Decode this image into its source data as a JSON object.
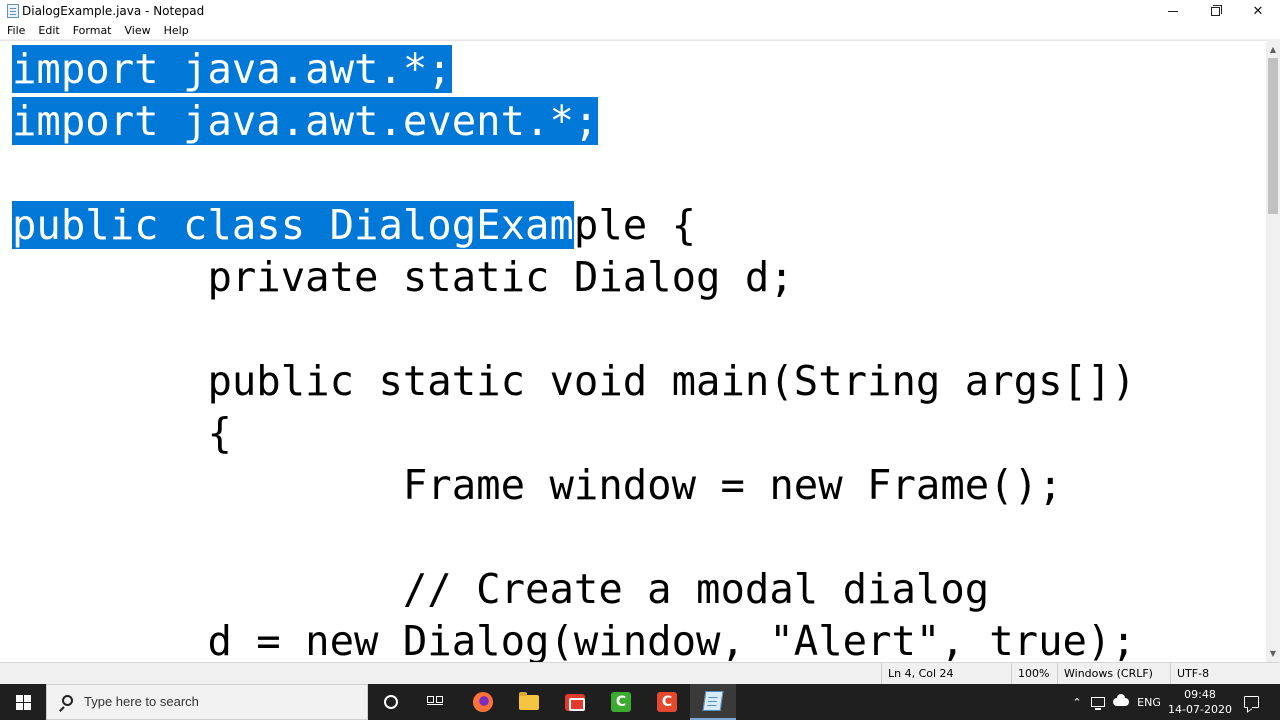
{
  "window": {
    "title": "DialogExample.java - Notepad",
    "controls": {
      "minimize_icon": "minimize-icon",
      "maximize_icon": "restore-icon",
      "close_icon": "close-icon"
    }
  },
  "menu": {
    "items": [
      "File",
      "Edit",
      "Format",
      "View",
      "Help"
    ]
  },
  "editor": {
    "selection_color": "#0078d7",
    "lines": [
      {
        "sel": "import java.awt.*;",
        "rest": ""
      },
      {
        "sel": "import java.awt.event.*;",
        "rest": ""
      },
      {
        "sel": "",
        "rest": ""
      },
      {
        "sel": "public class DialogExam",
        "rest": "ple {"
      },
      {
        "sel": "",
        "rest": "\t\tprivate static Dialog d;"
      },
      {
        "sel": "",
        "rest": ""
      },
      {
        "sel": "",
        "rest": "\t\tpublic static void main(String args[])"
      },
      {
        "sel": "",
        "rest": "\t\t{"
      },
      {
        "sel": "",
        "rest": "\t\t\t\tFrame window = new Frame();"
      },
      {
        "sel": "",
        "rest": ""
      },
      {
        "sel": "",
        "rest": "\t\t\t\t// Create a modal dialog"
      },
      {
        "sel": "",
        "rest": "\t\td = new Dialog(window, \"Alert\", true);"
      }
    ]
  },
  "status": {
    "position": "Ln 4, Col 24",
    "zoom": "100%",
    "line_endings": "Windows (CRLF)",
    "encoding": "UTF-8"
  },
  "taskbar": {
    "search_placeholder": "Type here to search",
    "apps": [
      "cortana-icon",
      "task-view-icon",
      "firefox-icon",
      "file-explorer-icon",
      "screencast-icon",
      "camtasia-icon",
      "camtasia-recorder-icon",
      "notepad-icon"
    ],
    "tray": {
      "language": "ENG",
      "time": "09:48",
      "date": "14-07-2020"
    }
  }
}
